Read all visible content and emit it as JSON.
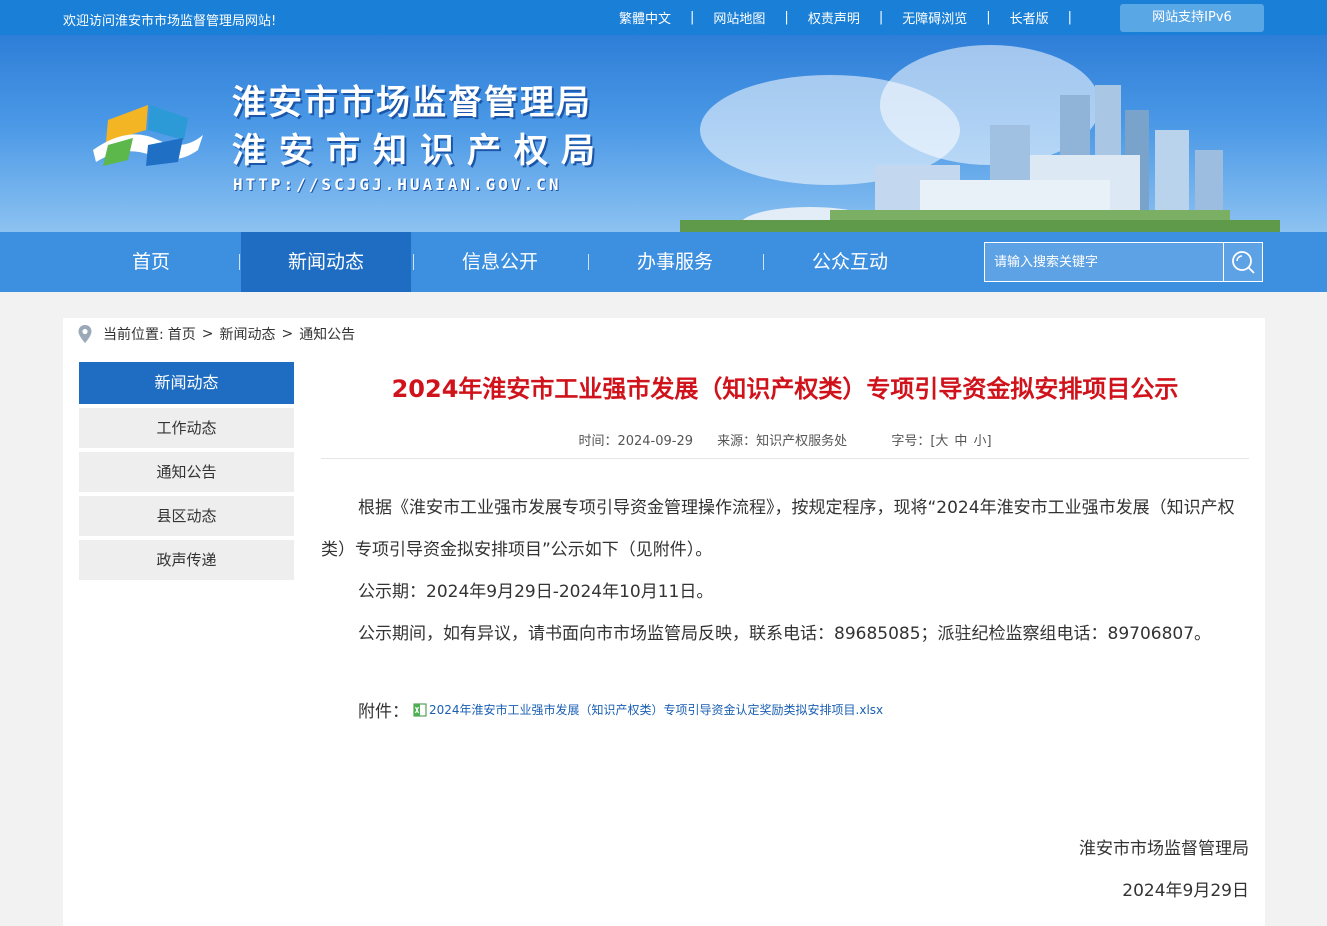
{
  "topbar": {
    "welcome": "欢迎访问淮安市市场监督管理局网站!",
    "links": [
      "繁體中文",
      "网站地图",
      "权责声明",
      "无障碍浏览",
      "长者版"
    ],
    "separator": "|",
    "ipv6": "网站支持IPv6"
  },
  "banner": {
    "title1": "淮安市市场监督管理局",
    "title2": "淮安市知识产权局",
    "url": "HTTP://SCJGJ.HUAIAN.GOV.CN"
  },
  "nav": {
    "items": [
      "首页",
      "新闻动态",
      "信息公开",
      "办事服务",
      "公众互动"
    ],
    "active_index": 1,
    "search_placeholder": "请输入搜索关键字"
  },
  "breadcrumb": {
    "prefix": "当前位置:",
    "items": [
      "首页",
      "新闻动态",
      "通知公告"
    ],
    "separator": ">"
  },
  "sidebar": {
    "heading": "新闻动态",
    "items": [
      "工作动态",
      "通知公告",
      "县区动态",
      "政声传递"
    ]
  },
  "article": {
    "title": "2024年淮安市工业强市发展（知识产权类）专项引导资金拟安排项目公示",
    "time": "时间：2024-09-29",
    "source": "来源：知识产权服务处",
    "fontsize_label": "字号：[",
    "fs_large": "大",
    "fs_medium": "中",
    "fs_small": "小",
    "fontsize_close": "]",
    "paragraphs": [
      "根据《淮安市工业强市发展专项引导资金管理操作流程》，按规定程序，现将“2024年淮安市工业强市发展（知识产权类）专项引导资金拟安排项目”公示如下（见附件）。",
      "公示期：2024年9月29日-2024年10月11日。",
      "公示期间，如有异议，请书面向市市场监管局反映，联系电话：89685085；派驻纪检监察组电话：89706807。"
    ],
    "attachment_label": "附件：",
    "attachment_name": "2024年淮安市工业强市发展（知识产权类）专项引导资金认定奖励类拟安排项目.xlsx",
    "signature_org": "淮安市市场监督管理局",
    "signature_date": "2024年9月29日"
  },
  "colors": {
    "brand_blue": "#1e6dc2",
    "nav_blue": "#3d8fe0",
    "title_red": "#d0121b"
  }
}
